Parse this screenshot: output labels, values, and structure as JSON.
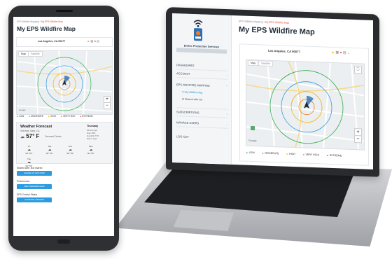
{
  "app": {
    "brand": "Emtec Protection Services",
    "breadcrumb_root": "EPS Wildfire Mapping",
    "breadcrumb_sep": " / ",
    "breadcrumb_current": "My EPS Wildfire Map",
    "page_title": "My EPS Wildfire Map",
    "location": "Los Angeles, CA 90077"
  },
  "sidebar": {
    "items": [
      {
        "label": "DASHBOARD"
      },
      {
        "label": "ACCOUNT"
      },
      {
        "label": "EPS WILDFIRE MAPPING"
      },
      {
        "label": "SUBSCRIPTIONS"
      },
      {
        "label": "MANAGE USERS"
      },
      {
        "label": "LOG OUT"
      }
    ],
    "sub_items": [
      {
        "label": "My Wildfire Map"
      },
      {
        "label": "Shared with me"
      }
    ]
  },
  "map": {
    "tabs": [
      "Map",
      "Satellite"
    ],
    "zoom_in": "+",
    "zoom_out": "−",
    "legend": [
      {
        "label": "LOW",
        "color": "#2eaa4a"
      },
      {
        "label": "MODERATE",
        "color": "#2d9be0"
      },
      {
        "label": "HIGH",
        "color": "#f0b400"
      },
      {
        "label": "VERY HIGH",
        "color": "#f07f1e"
      },
      {
        "label": "EXTREME",
        "color": "#e1483a"
      }
    ],
    "attribution": "Google"
  },
  "weather": {
    "title": "Weather Forecast",
    "location": "Sherman Oaks, CA",
    "temp": "57° F",
    "condition": "Overcast Clouds",
    "day": "Thursday",
    "details": [
      "Wind 4 mph",
      "Hum 39%",
      "Humidity 77%",
      "Rain 0 days"
    ],
    "days": [
      {
        "name": "Fri",
        "temps": "66° 55°"
      },
      {
        "name": "Sat",
        "temps": "66° 55°"
      },
      {
        "name": "Sun",
        "temps": "66° 55°"
      },
      {
        "name": "Mon",
        "temps": "66° 55°"
      },
      {
        "name": "Tue",
        "temps": "66° 55°"
      }
    ]
  },
  "phone_actions": {
    "shared_label": "Shared with: Not shared",
    "share_button": "SHARE MY EPS MAP",
    "prefs_label": "Preferences",
    "prefs_button": "SEE PREFERENCES",
    "control_label": "EPS Control Status",
    "control_button": "CONTROL CENTER"
  },
  "colors": {
    "accent": "#2d9be0",
    "highlight": "#e1483a",
    "title": "#1f2a36"
  }
}
